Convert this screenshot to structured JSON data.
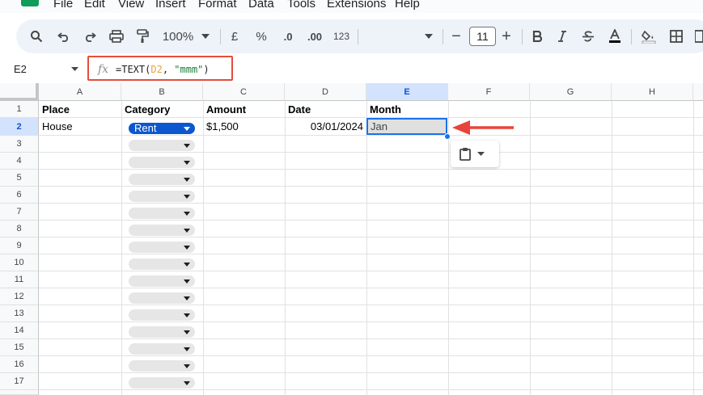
{
  "menu": [
    "File",
    "Edit",
    "View",
    "Insert",
    "Format",
    "Data",
    "Tools",
    "Extensions",
    "Help"
  ],
  "toolbar": {
    "zoom": "100%",
    "currency": "£",
    "percent": "%",
    "decrease_decimal": ".0",
    "increase_decimal": ".00",
    "number_format": "123",
    "font_size": "11",
    "minus": "−",
    "plus": "+"
  },
  "formula_bar": {
    "name_box": "E2",
    "fx": "fx",
    "formula_prefix": "=TEXT(",
    "formula_ref": "D2",
    "formula_sep": ", ",
    "formula_string": "\"mmm\"",
    "formula_suffix": ")"
  },
  "grid": {
    "columns": [
      "A",
      "B",
      "C",
      "D",
      "E",
      "F",
      "G",
      "H"
    ],
    "rows": [
      "1",
      "2",
      "3",
      "4",
      "5",
      "6",
      "7",
      "8",
      "9",
      "10",
      "11",
      "12",
      "13",
      "14",
      "15",
      "16",
      "17"
    ],
    "selected_cell": "E2",
    "headers": {
      "a1": "Place",
      "b1": "Category",
      "c1": "Amount",
      "d1": "Date",
      "e1": "Month"
    },
    "row2": {
      "a2": "House",
      "b2": "Rent",
      "c2": "$1,500",
      "d2": "03/01/2024",
      "e2": "Jan"
    }
  },
  "colors": {
    "selection": "#1a73e8",
    "highlight_box": "#e74c3c",
    "chip_selected": "#0b57d0",
    "chip_empty": "#e6e6e6"
  },
  "icons": [
    "search-icon",
    "undo-icon",
    "redo-icon",
    "print-icon",
    "paint-format-icon",
    "bold-icon",
    "italic-icon",
    "strikethrough-icon",
    "text-color-icon",
    "fill-color-icon",
    "borders-icon",
    "clipboard-icon"
  ]
}
